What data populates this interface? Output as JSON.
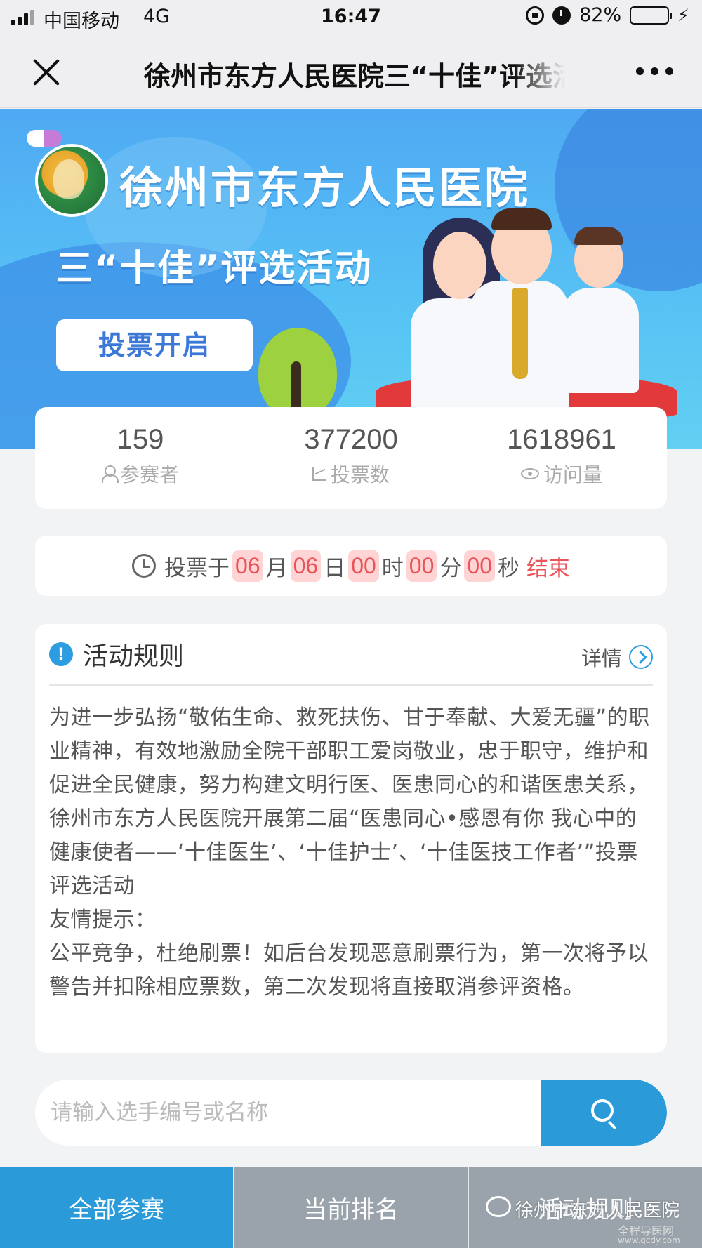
{
  "status_bar": {
    "carrier": "中国移动",
    "network": "4G",
    "time": "16:47",
    "battery": "82%",
    "battery_level": 0.82,
    "icons": [
      "signal-icon",
      "orientation-lock-icon",
      "alarm-icon",
      "battery-icon",
      "charging-icon"
    ]
  },
  "nav": {
    "title": "徐州市东方人民医院三“十佳”评选活动",
    "close_icon": "close-icon",
    "more_icon": "more-icon"
  },
  "banner": {
    "hospital_name": "徐州市东方人民医院",
    "activity_title": "三“十佳”评选活动",
    "vote_open_label": "投票开启"
  },
  "stats": [
    {
      "value": "159",
      "label": "参赛者",
      "icon": "user-icon"
    },
    {
      "value": "377200",
      "label": "投票数",
      "icon": "chart-icon"
    },
    {
      "value": "1618961",
      "label": "访问量",
      "icon": "eye-icon"
    }
  ],
  "countdown": {
    "prefix": "投票于",
    "month": "06",
    "month_unit": "月",
    "day": "06",
    "day_unit": "日",
    "hour": "00",
    "hour_unit": "时",
    "minute": "00",
    "minute_unit": "分",
    "second": "00",
    "second_unit": "秒",
    "suffix": "结束",
    "accent_color": "#e9545a"
  },
  "rules": {
    "title": "活动规则",
    "details_label": "详情",
    "paragraph1": "为进一步弘扬“敬佑生命、救死扶伤、甘于奉献、大爱无疆”的职业精神，有效地激励全院干部职工爱岗敬业，忠于职守，维护和促进全民健康，努力构建文明行医、医患同心的和谐医患关系，徐州市东方人民医院开展第二届“医患同心•感恩有你 我心中的健康使者——‘十佳医生’、‘十佳护士’、‘十佳医技工作者’”投票评选活动",
    "tip_label": "友情提示：",
    "paragraph2": "公平竞争，杜绝刷票！如后台发现恶意刷票行为，第一次将予以警告并扣除相应票数，第二次发现将直接取消参评资格。"
  },
  "search": {
    "placeholder": "请输入选手编号或名称",
    "value": ""
  },
  "tabs": [
    {
      "label": "全部参赛",
      "active": true
    },
    {
      "label": "当前排名",
      "active": false
    },
    {
      "label": "活动规则",
      "active": false
    }
  ],
  "watermark": {
    "text": "徐州市东方人民医院",
    "site": "全程导医网",
    "url": "www.qcdy.com"
  },
  "colors": {
    "primary": "#2a9ad8",
    "tab_inactive": "#9aa3ab",
    "background": "#f2f3f5"
  }
}
